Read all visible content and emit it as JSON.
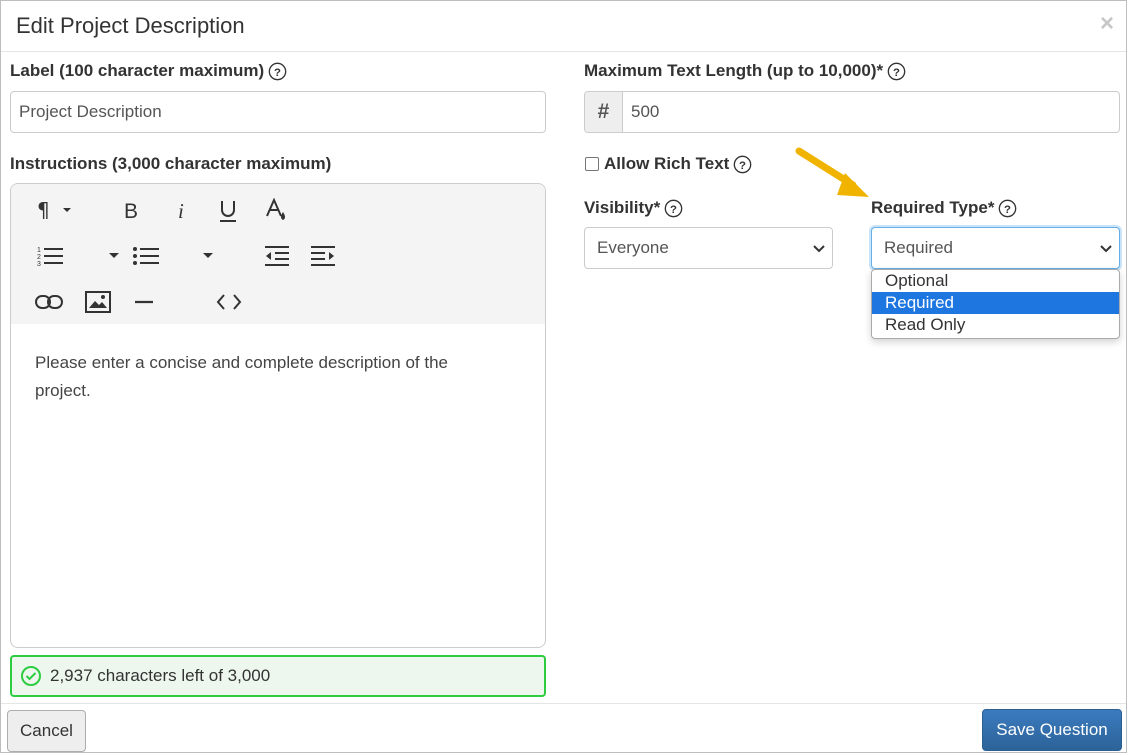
{
  "dialog": {
    "title": "Edit Project Description",
    "close_glyph": "×"
  },
  "label_field": {
    "label": "Label (100 character maximum)",
    "value": "Project Description"
  },
  "max_length": {
    "label": "Maximum Text Length (up to 10,000)*",
    "addon": "#",
    "value": "500"
  },
  "instructions": {
    "label": "Instructions (3,000 character maximum)",
    "body": "Please enter a concise and complete description of the project.",
    "toolbar_icons": [
      "paragraph-icon",
      "bold-icon",
      "italic-icon",
      "underline-icon",
      "text-color-icon",
      "ordered-list-icon",
      "unordered-list-icon",
      "outdent-icon",
      "indent-icon",
      "link-icon",
      "image-icon",
      "horizontal-rule-icon",
      "code-view-icon"
    ]
  },
  "counter": {
    "text": "2,937 characters left of 3,000",
    "color": "#2ecc40"
  },
  "rich_text": {
    "label": "Allow Rich Text",
    "checked": false
  },
  "visibility": {
    "label": "Visibility*",
    "value": "Everyone"
  },
  "required_type": {
    "label": "Required Type*",
    "value": "Required",
    "options": [
      "Optional",
      "Required",
      "Read Only"
    ],
    "selected_index": 1
  },
  "footer": {
    "cancel_label": "Cancel",
    "save_label": "Save Question"
  },
  "colors": {
    "primary": "#2c6399",
    "highlight": "#1e76e0",
    "arrow": "#f0b400"
  }
}
